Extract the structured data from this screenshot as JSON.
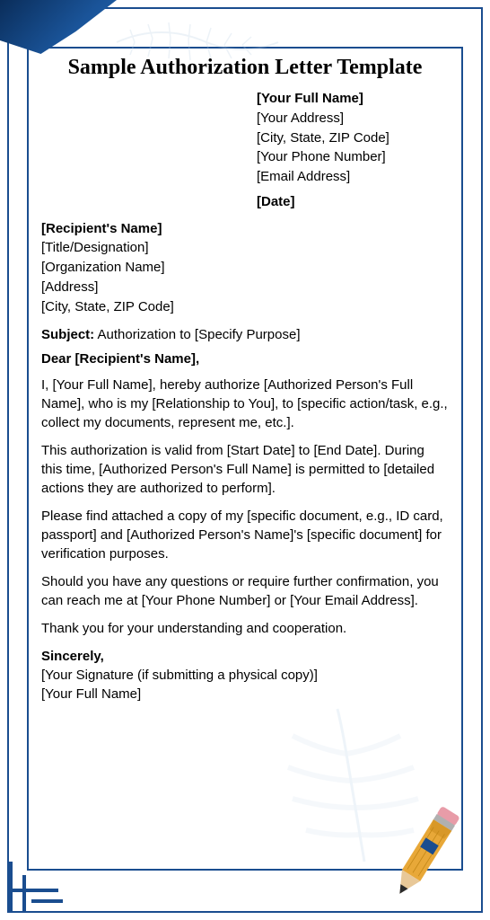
{
  "title": "Sample Authorization Letter Template",
  "sender": {
    "name": "[Your Full Name]",
    "address": "[Your Address]",
    "citystate": "[City, State, ZIP Code]",
    "phone": "[Your Phone Number]",
    "email": "[Email Address]",
    "date": "[Date]"
  },
  "recipient": {
    "name": "[Recipient's Name]",
    "title": "[Title/Designation]",
    "org": "[Organization Name]",
    "address": "[Address]",
    "citystate": "[City, State, ZIP Code]"
  },
  "subject_label": "Subject:",
  "subject_text": " Authorization to [Specify Purpose]",
  "salutation": "Dear [Recipient's Name],",
  "para1": "I, [Your Full Name], hereby authorize [Authorized Person's Full Name], who is my [Relationship to You], to [specific action/task, e.g., collect my documents, represent me, etc.].",
  "para2": "This authorization is valid from [Start Date] to [End Date]. During this time, [Authorized Person's Full Name] is permitted to [detailed actions they are authorized to perform].",
  "para3": "Please find attached a copy of my [specific document, e.g., ID card, passport] and [Authorized Person's Name]'s [specific document] for verification purposes.",
  "para4": "Should you have any questions or require further confirmation, you can reach me at [Your Phone Number] or [Your Email Address].",
  "para5": "Thank you for your understanding and cooperation.",
  "closing": {
    "sign_off": "Sincerely,",
    "signature": "[Your Signature (if submitting a physical copy)]",
    "name": "[Your Full Name]"
  }
}
